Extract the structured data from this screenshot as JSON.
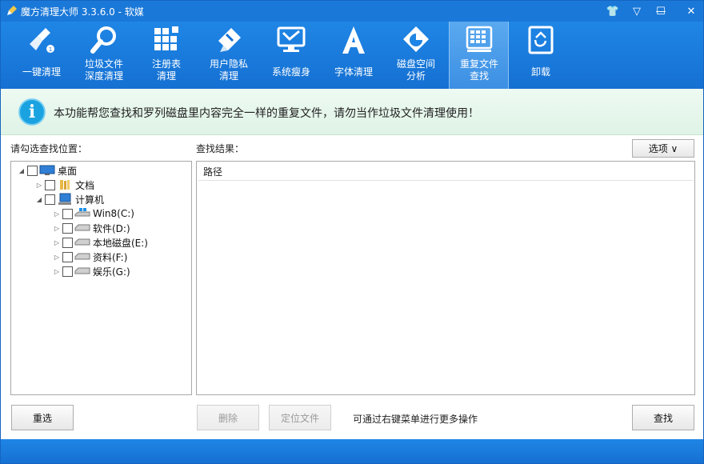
{
  "window": {
    "title": "魔方清理大师 3.3.6.0 - 软媒",
    "controls": {
      "skin": "👕",
      "menu": "▽",
      "minimize": "—",
      "maximize": "☐",
      "close": "✕"
    }
  },
  "toolbar": {
    "items": [
      {
        "label": "一键清理",
        "icon": "broom-icon"
      },
      {
        "label": "垃圾文件\n深度清理",
        "icon": "magnifier-icon"
      },
      {
        "label": "注册表\n清理",
        "icon": "registry-blocks-icon"
      },
      {
        "label": "用户隐私\n清理",
        "icon": "privacy-eraser-icon"
      },
      {
        "label": "系统瘦身",
        "icon": "monitor-icon"
      },
      {
        "label": "字体清理",
        "icon": "font-a-icon"
      },
      {
        "label": "磁盘空间\n分析",
        "icon": "disk-pie-icon"
      },
      {
        "label": "重复文件\n查找",
        "icon": "duplicate-grid-icon",
        "active": true
      },
      {
        "label": "卸载",
        "icon": "recycle-icon"
      }
    ]
  },
  "banner": {
    "text": "本功能帮您查找和罗列磁盘里内容完全一样的重复文件，请勿当作垃圾文件清理使用！"
  },
  "left": {
    "label": "请勾选查找位置：",
    "tree": [
      {
        "label": "桌面"
      },
      {
        "label": "文档"
      },
      {
        "label": "计算机"
      },
      {
        "label": "Win8(C:)"
      },
      {
        "label": "软件(D:)"
      },
      {
        "label": "本地磁盘(E:)"
      },
      {
        "label": "资料(F:)"
      },
      {
        "label": "娱乐(G:)"
      }
    ]
  },
  "right": {
    "label": "查找结果：",
    "options_label": "选项 ∨",
    "column_path": "路径"
  },
  "buttons": {
    "reselect": "重选",
    "delete": "删除",
    "locate": "定位文件",
    "hint": "可通过右键菜单进行更多操作",
    "search": "查找"
  }
}
